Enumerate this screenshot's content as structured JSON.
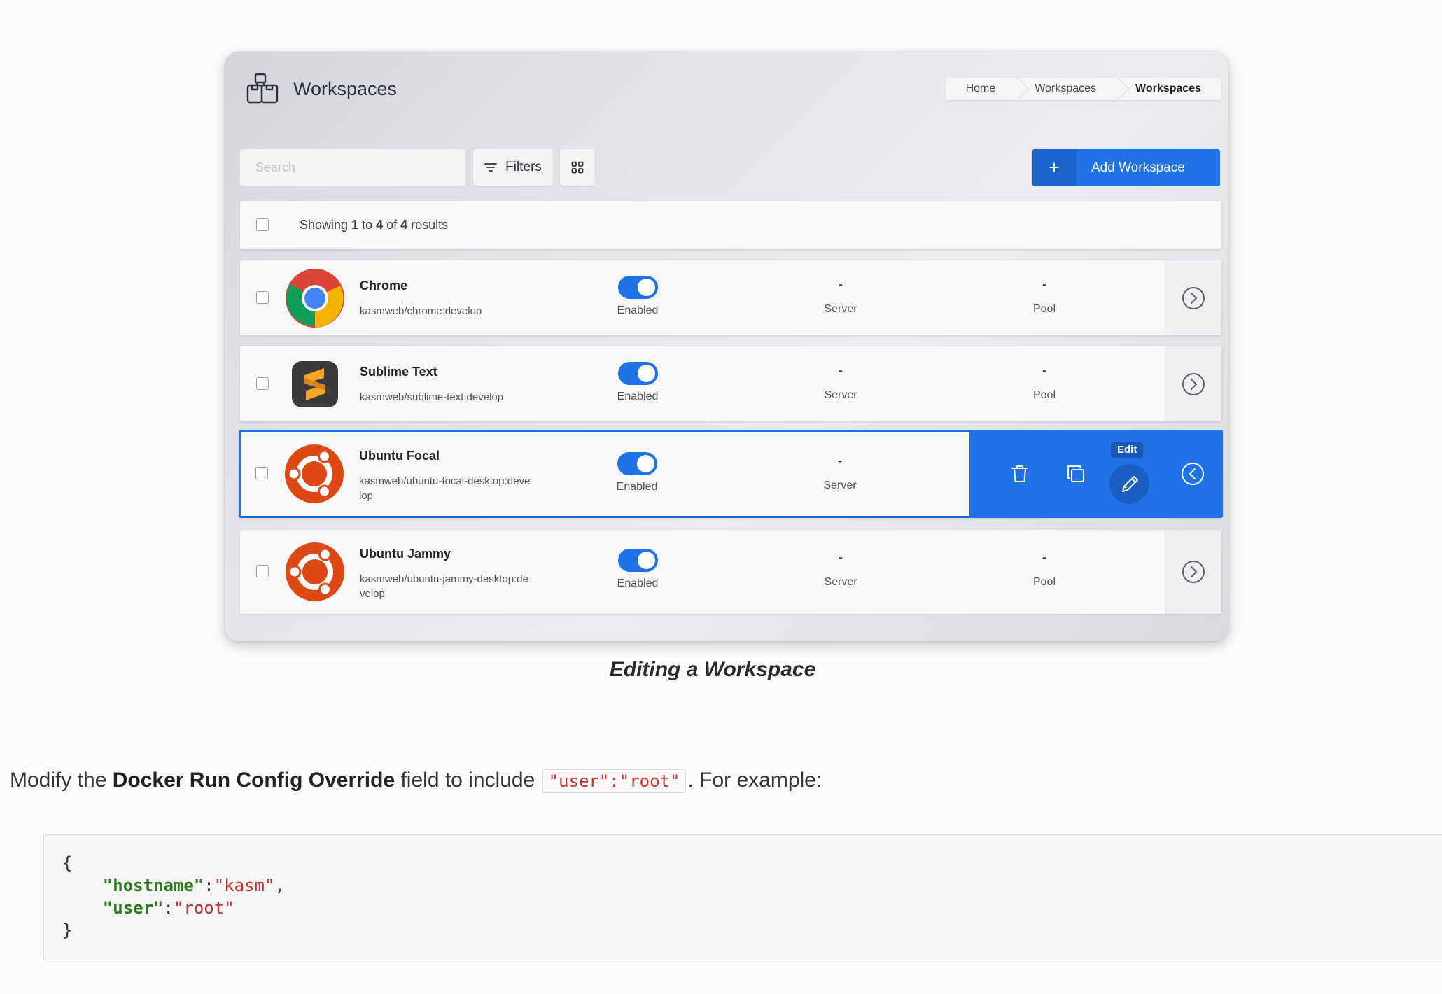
{
  "header": {
    "title": "Workspaces",
    "breadcrumbs": [
      "Home",
      "Workspaces",
      "Workspaces"
    ]
  },
  "toolbar": {
    "search_placeholder": "Search",
    "filters_label": "Filters",
    "add_label": "Add Workspace",
    "add_icon": "+"
  },
  "results": {
    "prefix": "Showing ",
    "from": "1",
    "to_word": " to ",
    "to": "4",
    "of_word": " of ",
    "total": "4",
    "suffix": " results"
  },
  "workspaces": [
    {
      "name": "Chrome",
      "image": "kasmweb/chrome:develop",
      "status": "Enabled",
      "server_value": "-",
      "server_label": "Server",
      "pool_value": "-",
      "pool_label": "Pool",
      "logo": "chrome-logo-icon"
    },
    {
      "name": "Sublime Text",
      "image": "kasmweb/sublime-text:develop",
      "status": "Enabled",
      "server_value": "-",
      "server_label": "Server",
      "pool_value": "-",
      "pool_label": "Pool",
      "logo": "sublime-text-logo-icon"
    },
    {
      "name": "Ubuntu Focal",
      "image": "kasmweb/ubuntu-focal-desktop:develop",
      "status": "Enabled",
      "server_value": "-",
      "server_label": "Server",
      "logo": "ubuntu-logo-icon",
      "edit_tooltip": "Edit"
    },
    {
      "name": "Ubuntu Jammy",
      "image": "kasmweb/ubuntu-jammy-desktop:develop",
      "status": "Enabled",
      "server_value": "-",
      "server_label": "Server",
      "pool_value": "-",
      "pool_label": "Pool",
      "logo": "ubuntu-logo-icon"
    }
  ],
  "colors": {
    "accent": "#1f73e6",
    "ubuntu": "#dd4814"
  },
  "caption": "Editing a Workspace",
  "instruction": {
    "before": "Modify the ",
    "bold": "Docker Run Config Override",
    "middle": " field to include ",
    "code": "\"user\":\"root\"",
    "after": ". For example:"
  },
  "code_block": {
    "open": "{",
    "line1_key": "\"hostname\"",
    "line1_sep": ":",
    "line1_val": "\"kasm\"",
    "line1_end": ",",
    "line2_key": "\"user\"",
    "line2_sep": ":",
    "line2_val": "\"root\"",
    "close": "}"
  }
}
